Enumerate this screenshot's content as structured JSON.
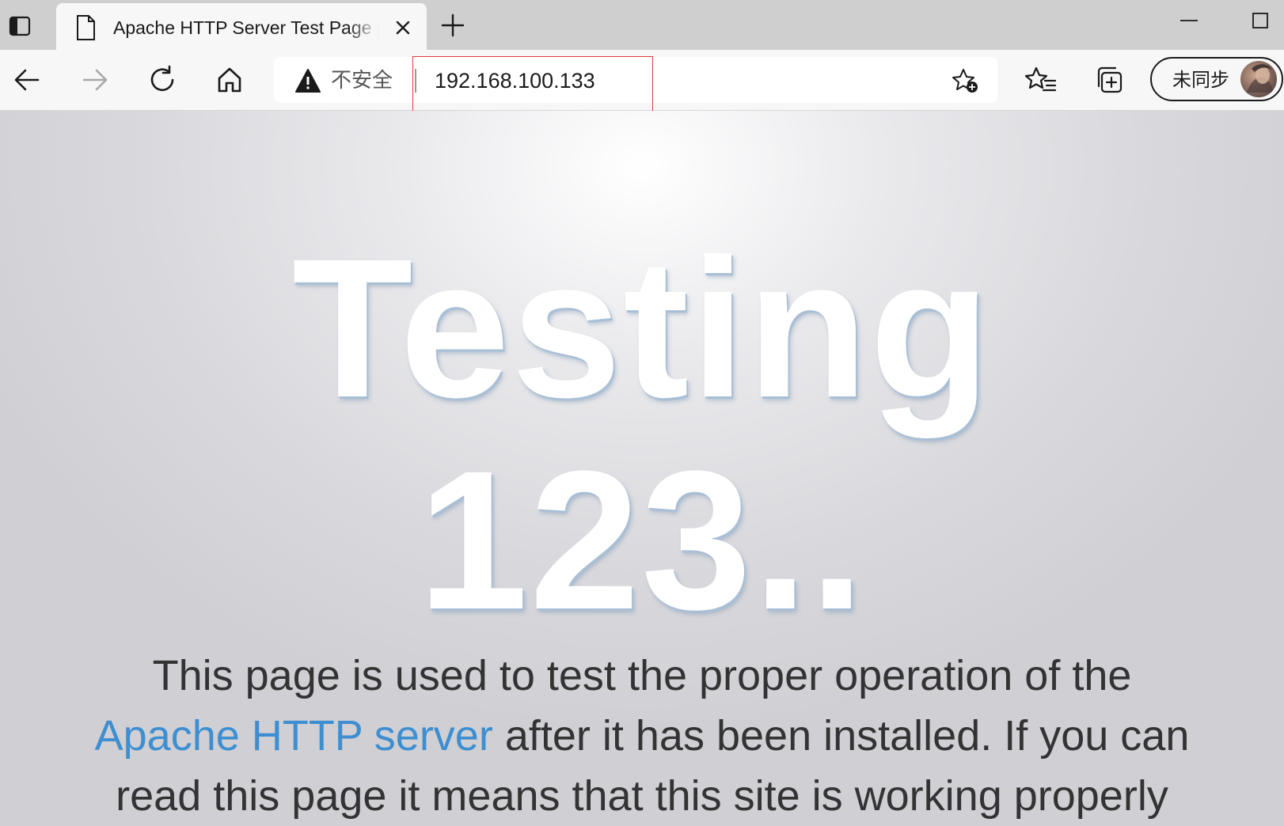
{
  "browser": {
    "tab": {
      "title": "Apache HTTP Server Test Page powered by CentOS"
    },
    "address_bar": {
      "security_label": "不安全",
      "url": "192.168.100.133"
    },
    "profile": {
      "sync_label": "未同步"
    }
  },
  "page": {
    "headline_line1": "Testing",
    "headline_line2": "123..",
    "intro_before_link": "This page is used to test the proper operation of the",
    "intro_link": "Apache HTTP server",
    "intro_after_link": "after it has been installed. If you can",
    "intro_line3": "read this page it means that this site is working properly"
  },
  "colors": {
    "link": "#3d8fd1",
    "highlight_box": "#e03b3b"
  }
}
